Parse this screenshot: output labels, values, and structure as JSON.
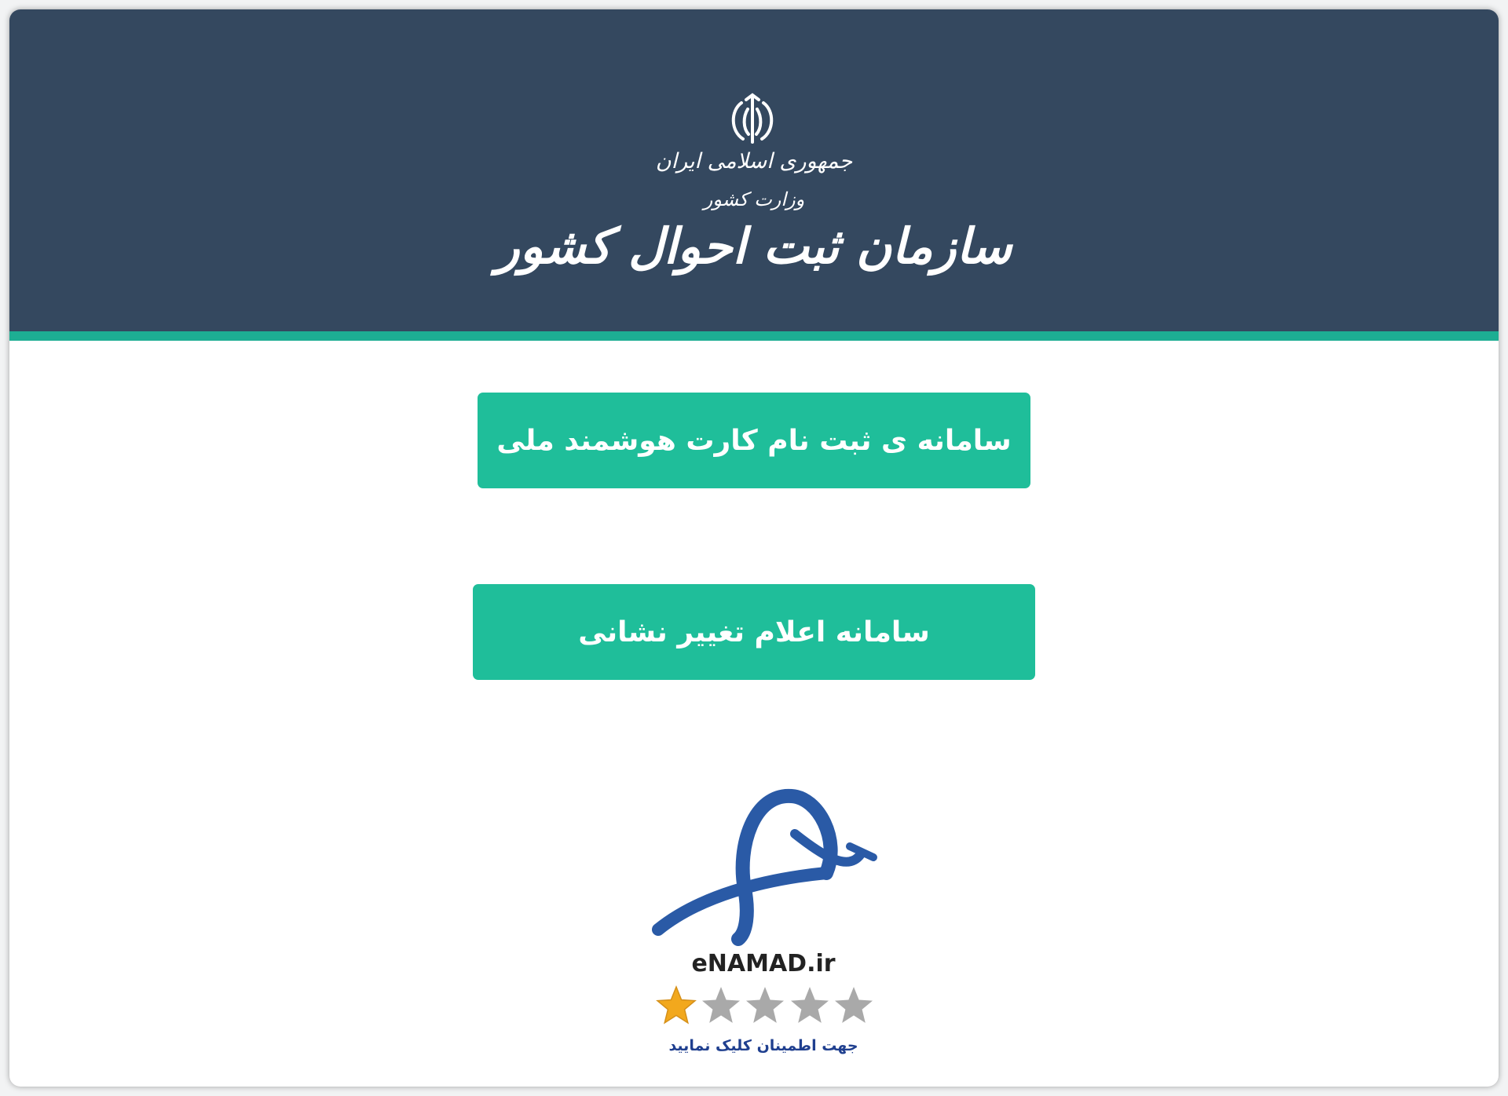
{
  "header": {
    "republic_name": "جمهوری اسلامی ایران",
    "ministry_name": "وزارت کشور",
    "organization_title": "سازمان ثبت احوال کشور"
  },
  "buttons": {
    "smart_card_registration": "سامانه ی ثبت نام کارت هوشمند ملی",
    "address_change": "سامانه اعلام تغییر نشانی"
  },
  "enamad": {
    "name": "eNAMAD.ir",
    "rating": 1,
    "max_rating": 5,
    "caption": "جهت اطمینان کلیک نمایید"
  },
  "colors": {
    "header_bg": "#34485f",
    "accent": "#1dae93",
    "button_bg": "#1fbe9a",
    "enamad_blue": "#2a5aa6",
    "star_active": "#f2a81d",
    "star_inactive": "#a9a9a9"
  },
  "icons": {
    "emblem": "iran-emblem-icon",
    "enamad_logo": "enamad-logo-icon",
    "star": "star-icon"
  }
}
